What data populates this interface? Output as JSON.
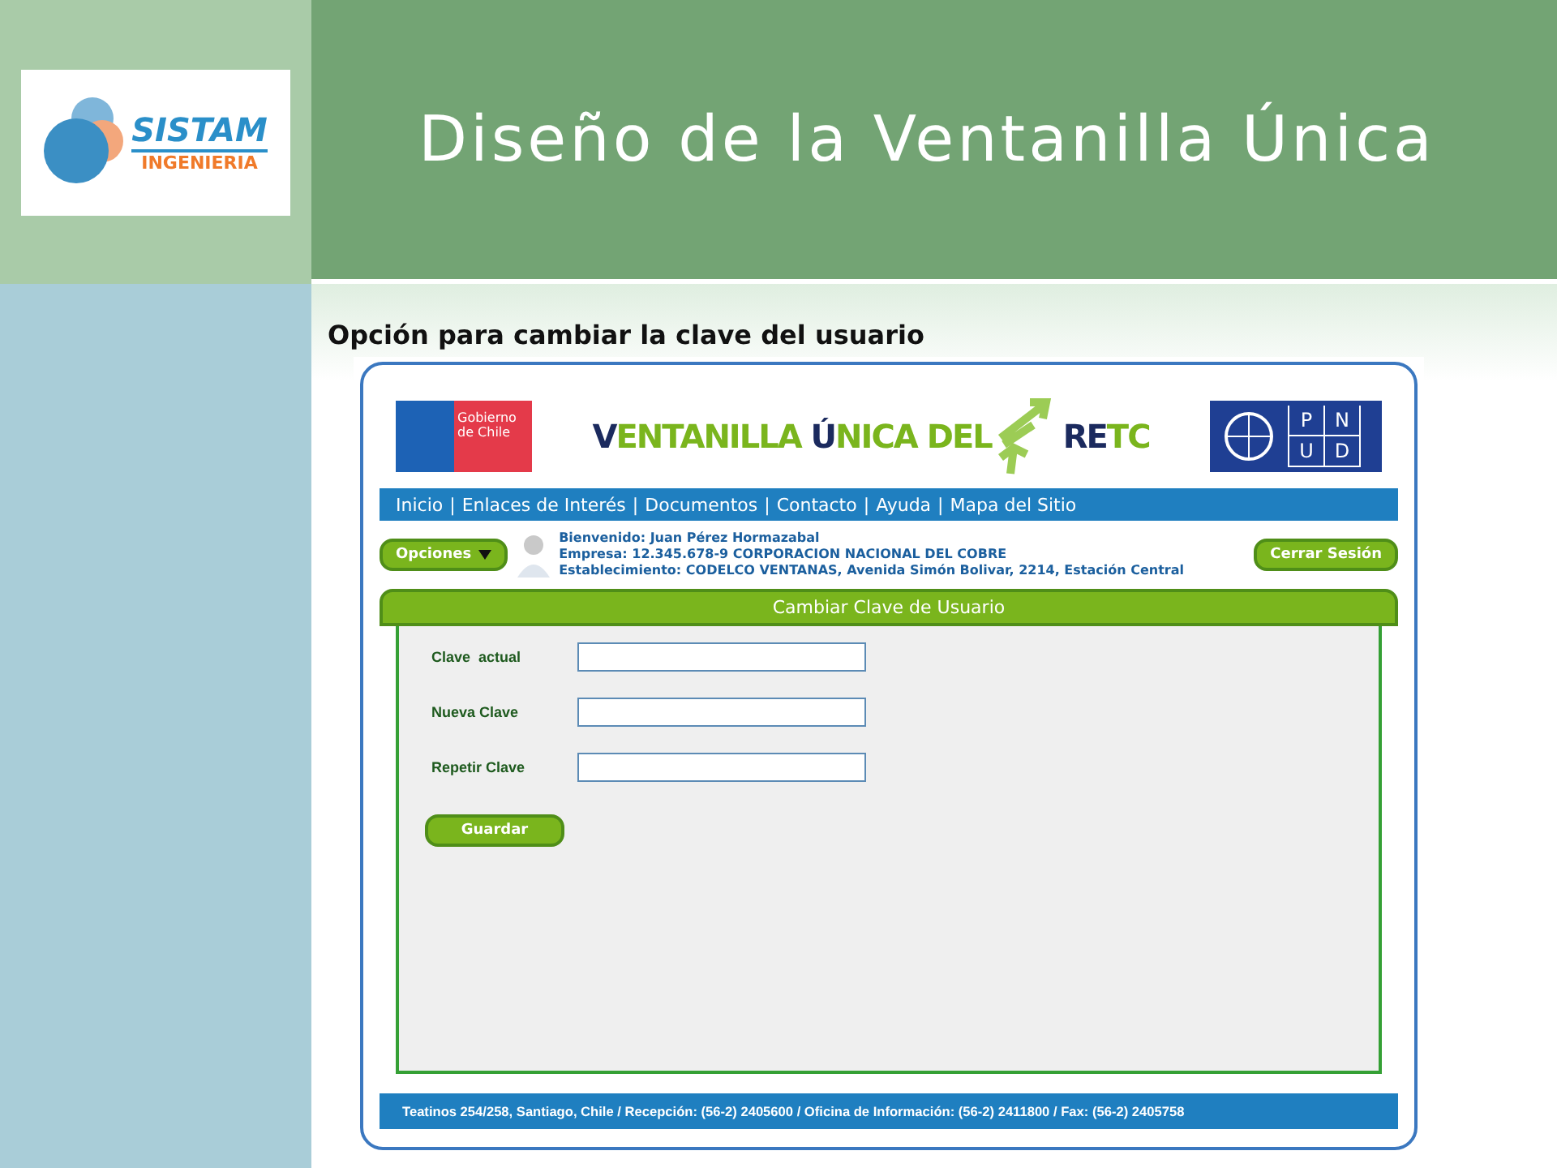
{
  "slide": {
    "title": "Diseño de la Ventanilla Única",
    "logo": {
      "name": "SISTAM",
      "subtitle": "INGENIERIA"
    },
    "caption": "Opción para cambiar la clave del usuario"
  },
  "site": {
    "gov_logo": [
      "Gobierno",
      "de Chile"
    ],
    "banner": [
      {
        "text": "V",
        "color": "#1b2a5e"
      },
      {
        "text": "ENTANILLA ",
        "color": "#7ab51d"
      },
      {
        "text": "Ú",
        "color": "#1b2a5e"
      },
      {
        "text": "NICA DEL",
        "color": "#7ab51d"
      }
    ],
    "banner_end": [
      {
        "text": "RE",
        "color": "#1b2a5e"
      },
      {
        "text": "TC",
        "color": "#7ab51d"
      }
    ],
    "undp_logo": [
      "P",
      "N",
      "U",
      "D"
    ],
    "nav": {
      "separator": "|",
      "items": [
        "Inicio",
        "Enlaces de Interés",
        "Documentos",
        "Contacto",
        "Ayuda",
        "Mapa del Sitio"
      ]
    },
    "options_button": "Opciones",
    "user_info": [
      "Bienvenido: Juan Pérez Hormazabal",
      "Empresa: 12.345.678-9 CORPORACION NACIONAL DEL COBRE",
      "Establecimiento:  CODELCO VENTANAS, Avenida Simón Bolivar, 2214, Estación Central"
    ],
    "logout_button": "Cerrar Sesión",
    "form": {
      "title": "Cambiar Clave de Usuario",
      "fields": [
        {
          "label": "Clave  actual"
        },
        {
          "label": "Nueva Clave"
        },
        {
          "label": "Repetir Clave"
        }
      ],
      "submit": "Guardar"
    },
    "footer": "Teatinos 254/258, Santiago, Chile / Recepción: (56-2) 2405600 / Oficina de Información: (56-2) 2411800 / Fax: (56-2) 2405758"
  }
}
